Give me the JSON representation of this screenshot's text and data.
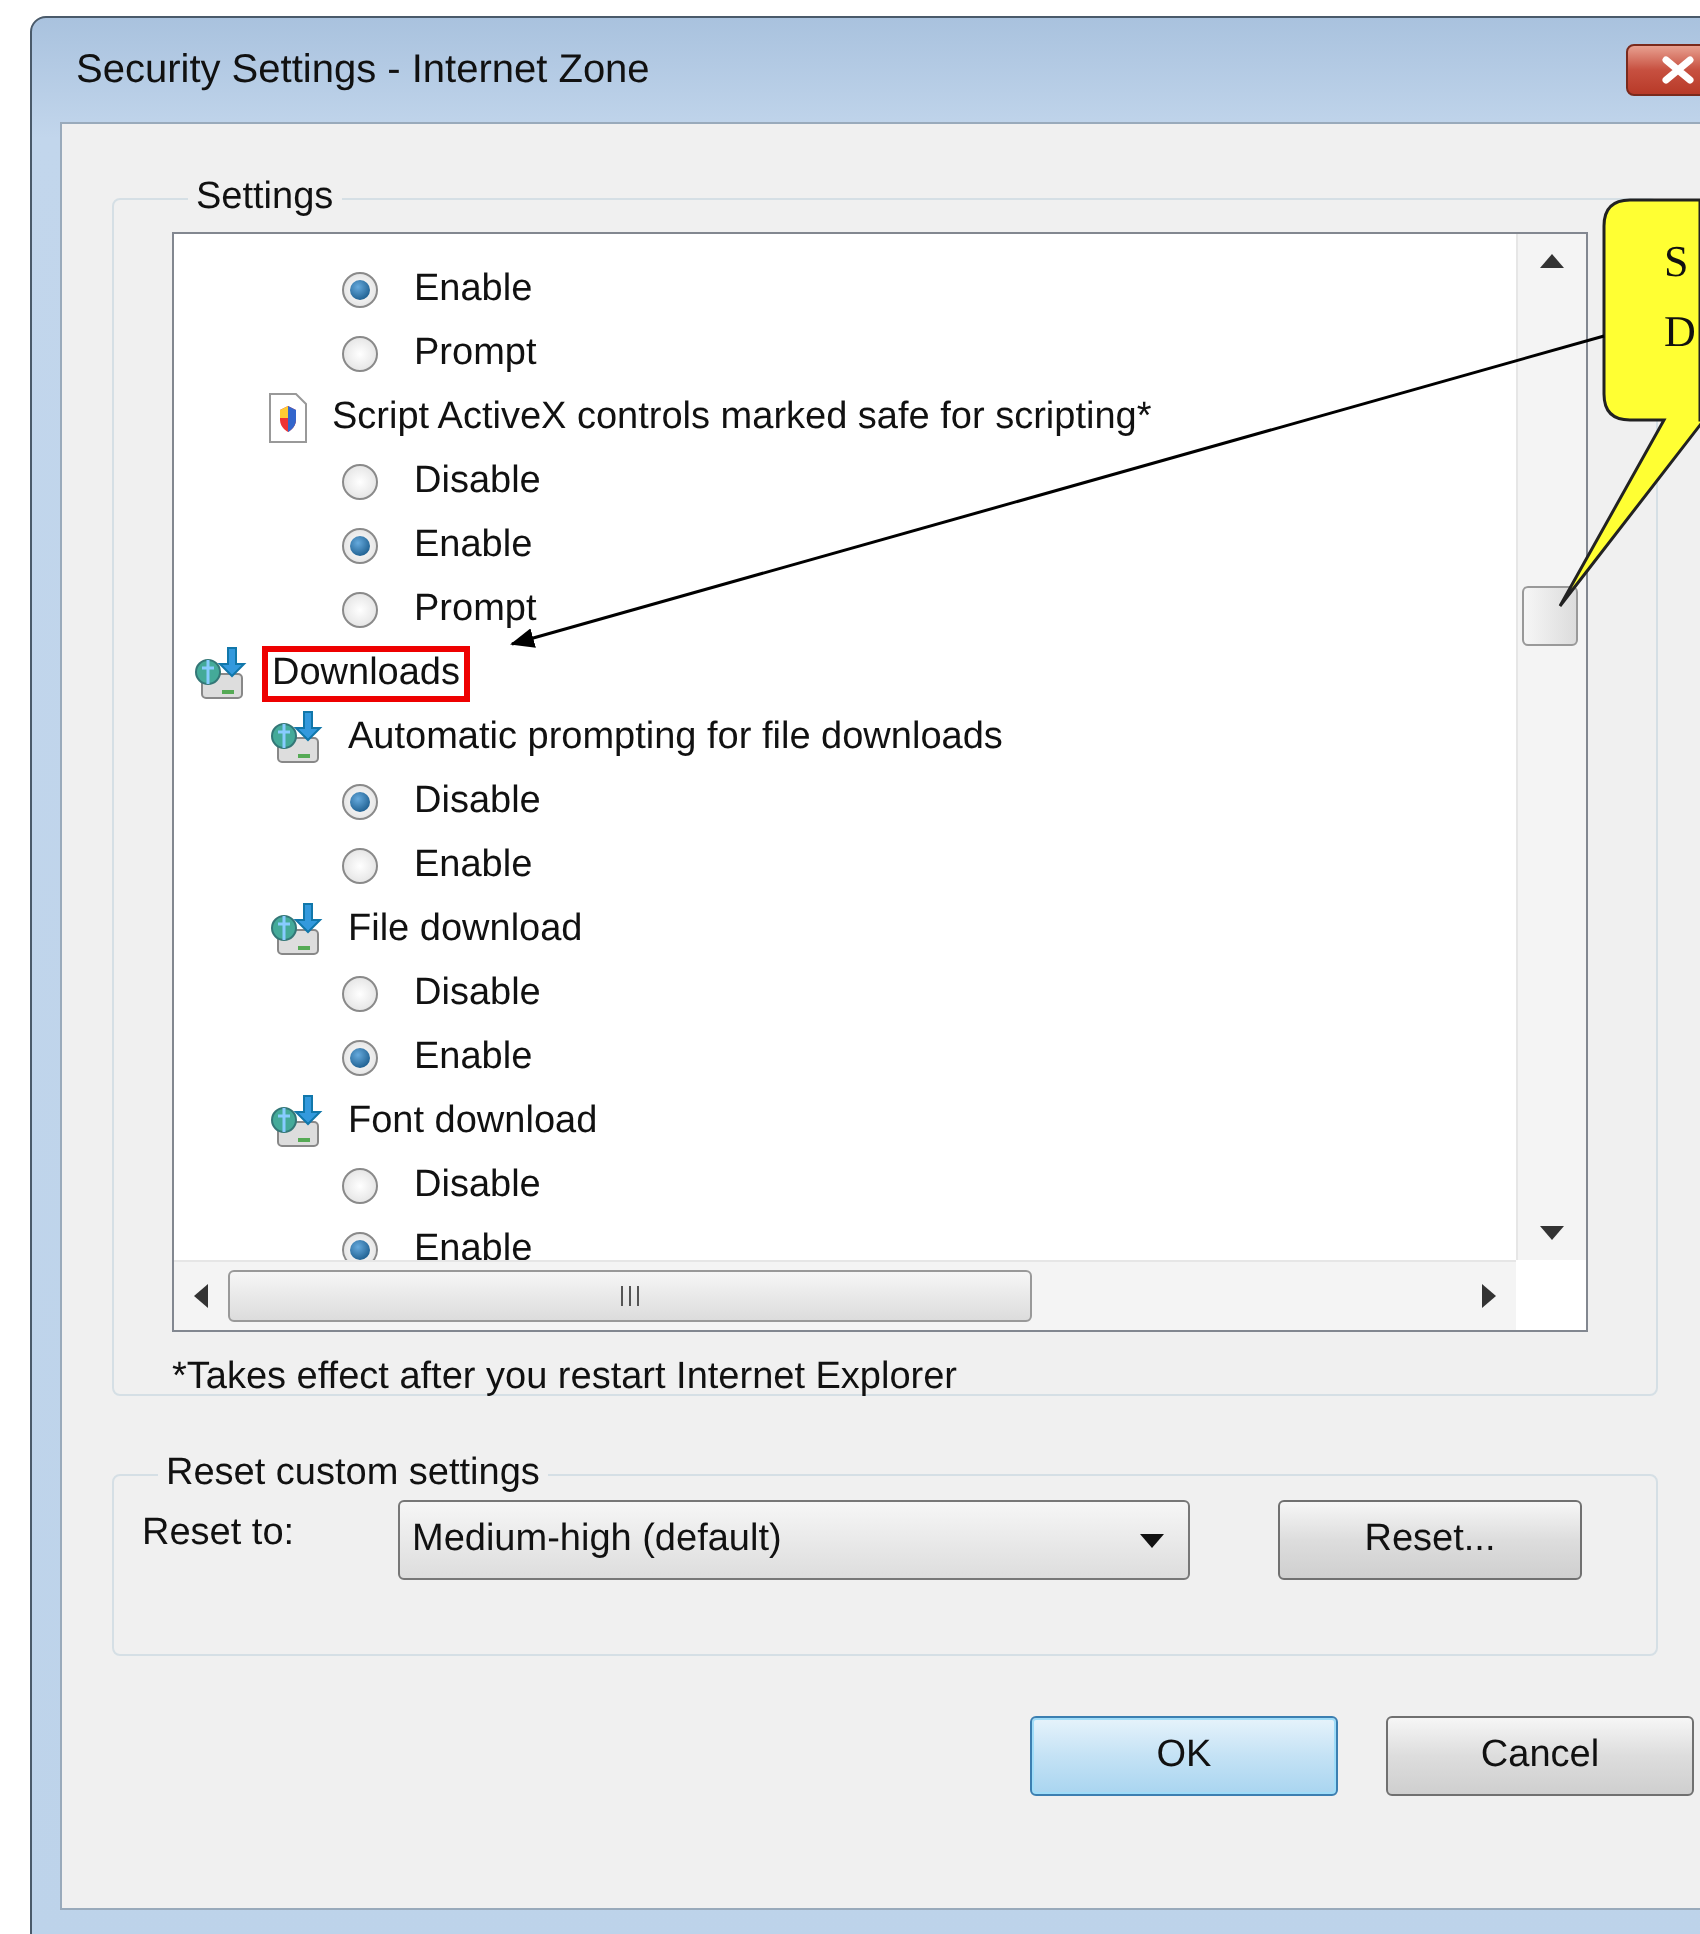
{
  "window": {
    "title": "Security Settings - Internet Zone"
  },
  "settings": {
    "legend": "Settings",
    "tree": [
      {
        "kind": "group",
        "children": [
          {
            "kind": "group",
            "children": [
              {
                "kind": "option",
                "label": "Enable",
                "selected": true
              },
              {
                "kind": "option",
                "label": "Prompt",
                "selected": false
              }
            ]
          },
          {
            "kind": "script",
            "label": "Script ActiveX controls marked safe for scripting*",
            "children": [
              {
                "kind": "option",
                "label": "Disable",
                "selected": false
              },
              {
                "kind": "option",
                "label": "Enable",
                "selected": true
              },
              {
                "kind": "option",
                "label": "Prompt",
                "selected": false
              }
            ]
          }
        ]
      },
      {
        "kind": "download",
        "label": "Downloads",
        "highlighted": true,
        "children": [
          {
            "kind": "download",
            "label": "Automatic prompting for file downloads",
            "children": [
              {
                "kind": "option",
                "label": "Disable",
                "selected": true
              },
              {
                "kind": "option",
                "label": "Enable",
                "selected": false
              }
            ]
          },
          {
            "kind": "download",
            "label": "File download",
            "children": [
              {
                "kind": "option",
                "label": "Disable",
                "selected": false
              },
              {
                "kind": "option",
                "label": "Enable",
                "selected": true
              }
            ]
          },
          {
            "kind": "download",
            "label": "Font download",
            "children": [
              {
                "kind": "option",
                "label": "Disable",
                "selected": false
              },
              {
                "kind": "option",
                "label": "Enable",
                "selected": true
              }
            ]
          }
        ]
      }
    ],
    "footnote": "*Takes effect after you restart Internet Explorer"
  },
  "reset": {
    "legend": "Reset custom settings",
    "label": "Reset to:",
    "value": "Medium-high (default)",
    "button": "Reset..."
  },
  "buttons": [
    {
      "label": "OK",
      "default": true
    },
    {
      "label": "Cancel",
      "default": false
    }
  ],
  "callout": {
    "lines": [
      "S",
      "D"
    ]
  }
}
